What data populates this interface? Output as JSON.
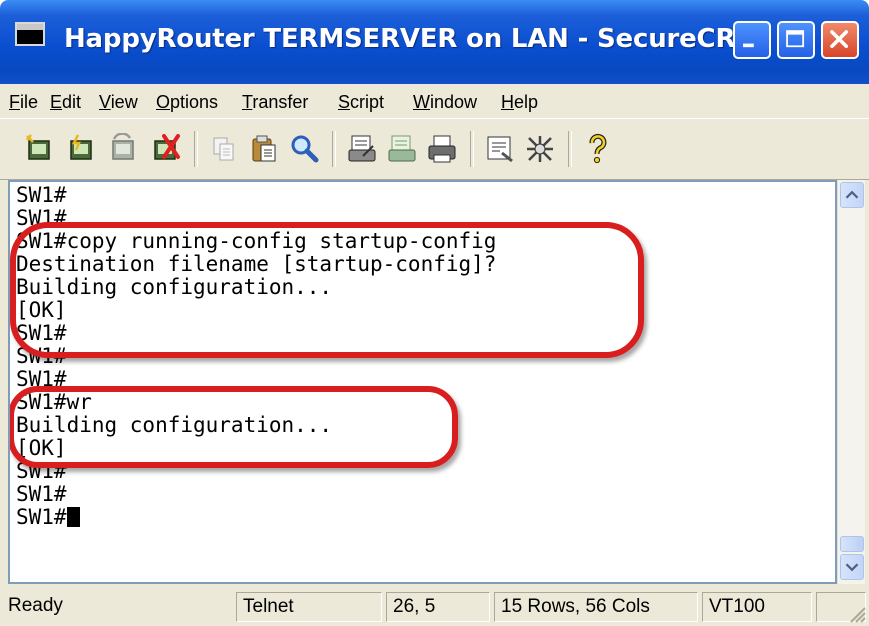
{
  "window": {
    "title": "HappyRouter TERMSERVER on LAN - SecureCRT"
  },
  "menu": {
    "items": [
      {
        "mnemonic": "F",
        "rest": "ile"
      },
      {
        "mnemonic": "E",
        "rest": "dit"
      },
      {
        "mnemonic": "V",
        "rest": "iew"
      },
      {
        "mnemonic": "O",
        "rest": "ptions"
      },
      {
        "mnemonic": "T",
        "rest": "ransfer"
      },
      {
        "mnemonic": "S",
        "rest": "cript"
      },
      {
        "mnemonic": "W",
        "rest": "indow"
      },
      {
        "mnemonic": "H",
        "rest": "elp"
      }
    ]
  },
  "toolbar": {
    "icons": [
      "connect-icon",
      "quick-connect-icon",
      "reconnect-icon",
      "disconnect-icon",
      "copy-icon",
      "paste-icon",
      "find-icon",
      "print-setup-icon",
      "print-selection-icon",
      "print-icon",
      "session-options-icon",
      "global-options-icon",
      "help-icon"
    ]
  },
  "terminal": {
    "lines": [
      "SW1#",
      "SW1#",
      "SW1#copy running-config startup-config",
      "Destination filename [startup-config]?",
      "Building configuration...",
      "[OK]",
      "SW1#",
      "SW1#",
      "SW1#",
      "SW1#wr",
      "Building configuration...",
      "[OK]",
      "SW1#",
      "SW1#",
      "SW1#"
    ]
  },
  "status": {
    "state": "Ready",
    "protocol": "Telnet",
    "position": "26,  5",
    "size": "15 Rows,  56 Cols",
    "emulation": "VT100"
  },
  "colors": {
    "annotation": "#d81e1e",
    "titlebar": "#0a4fd0"
  }
}
